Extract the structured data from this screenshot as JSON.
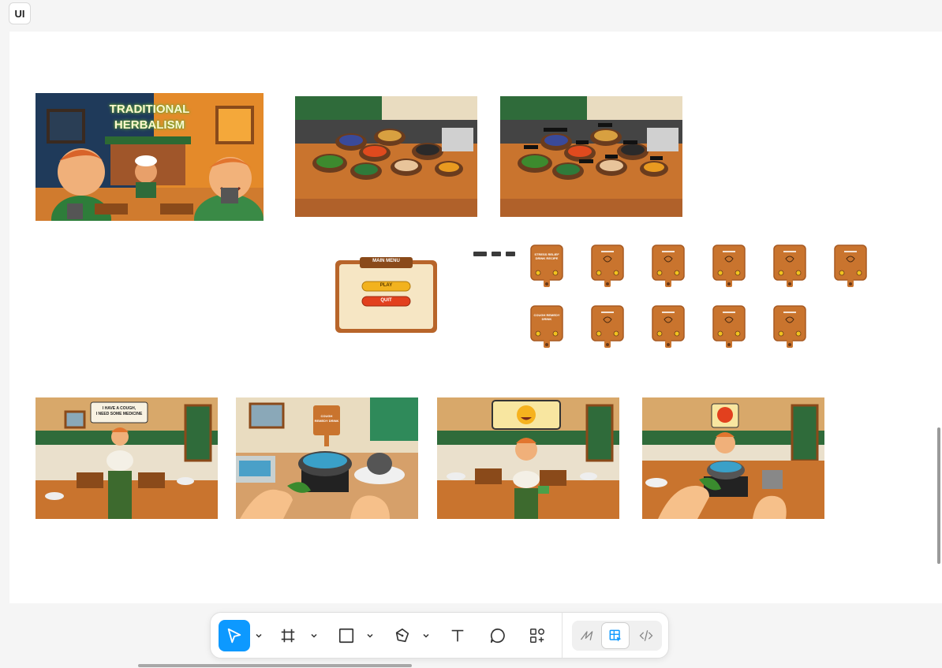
{
  "frame_label": "UI",
  "hero_title": [
    "TRADITIONAL",
    "HERBALISM"
  ],
  "main_menu": {
    "title": "MAIN MENU",
    "play": "PLAY",
    "quit": "QUIT"
  },
  "recipe_cards_row1": [
    "STRESS RELIEF DRINK RECIPE",
    "",
    "",
    "",
    "",
    ""
  ],
  "recipe_cards_row2": [
    "COUGH REMEDY DRINK",
    "",
    "",
    "",
    ""
  ],
  "scenes": {
    "customer_speech": [
      "I HAVE A COUGH,",
      "I NEED SOME MEDICINE"
    ],
    "cooking_card": [
      "COUGH",
      "REMEDY DRINK"
    ]
  },
  "toolbar": {
    "tools": [
      "move",
      "frame",
      "shape",
      "pen",
      "text",
      "comment",
      "actions"
    ],
    "modes": [
      "draw",
      "design",
      "dev"
    ]
  },
  "colors": {
    "accent": "#0d99ff",
    "wood": "#c9742e",
    "green": "#2f6b3a",
    "floor_dark": "#3b3b3b"
  }
}
